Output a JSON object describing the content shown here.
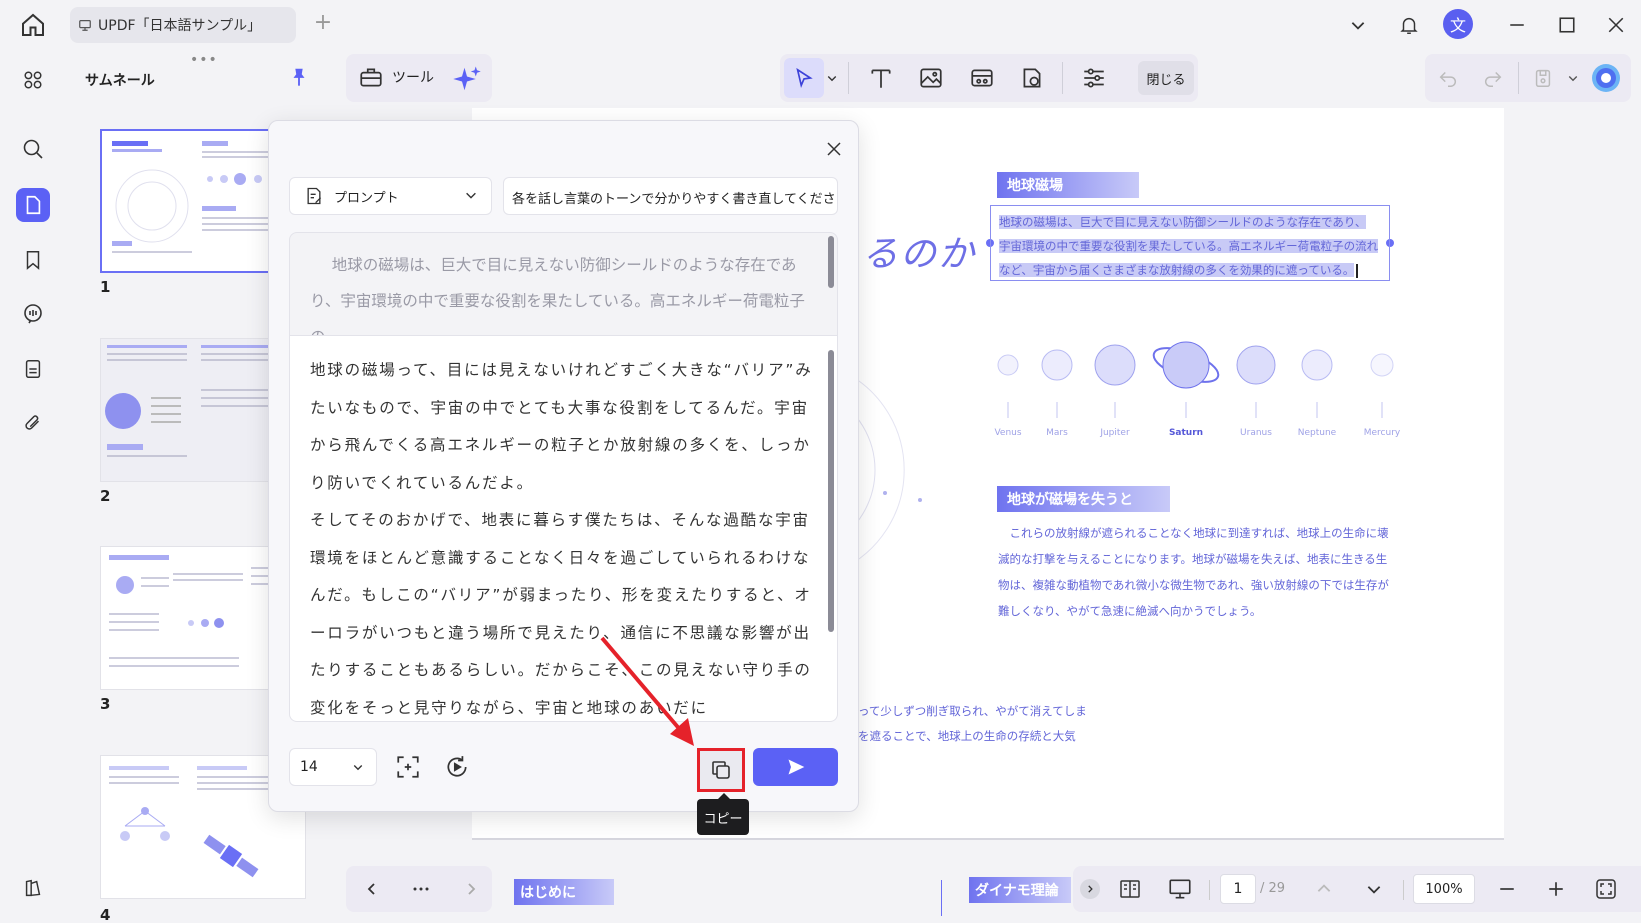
{
  "titlebar": {
    "tab_title": "UPDF「日本語サンプル」",
    "avatar_letter": "文"
  },
  "thumbnail_panel": {
    "title": "サムネール",
    "page_numbers": [
      "1",
      "2",
      "3",
      "4"
    ]
  },
  "toolbar": {
    "tools_label": "ツール",
    "close_label": "閉じる"
  },
  "document": {
    "title_fragment": "るのか",
    "section1_heading": "地球磁場",
    "section1_lines": [
      "地球の磁場は、巨大で目に見えない防御シールドのような存在であり、",
      "宇宙環境の中で重要な役割を果たしている。高エネルギー荷電粒子の流れ",
      "など、宇宙から届くさまざまな放射線の多くを効果的に遮っている。"
    ],
    "planets": [
      "Venus",
      "Mars",
      "Jupiter",
      "Saturn",
      "Uranus",
      "Neptune",
      "Mercury"
    ],
    "section2_heading": "地球が磁場を失うと",
    "section2_text": "これらの放射線が遮られることなく地球に到達すれば、地球上の生命に壊滅的な打撃を与えることになります。地球が磁場を失えば、地表に生きる生物は、複雑な動植物であれ微小な微生物であれ、強い放射線の下では生存が難しくなり、やがて急速に絶滅へ向かうでしょう。",
    "fragment1": "って少しずつ削ぎ取られ、やがて消えてしま",
    "fragment2": "を遮ることで、地球上の生命の存続と大気",
    "bookmark_left": "はじめに",
    "bookmark_right": "ダイナモ理論"
  },
  "ai_dialog": {
    "prompt_label": "プロンプト",
    "prompt_text": "各を話し言葉のトーンで分かりやすく書き直してください",
    "source_text": "地球の磁場は、巨大で目に見えない防御シールドのような存在であり、宇宙環境の中で重要な役割を果たしている。高エネルギー荷電粒子の",
    "result_paragraph1": "地球の磁場って、目には見えないけれどすごく大きな“バリア”みたいなもので、宇宙の中でとても大事な役割をしてるんだ。宇宙から飛んでくる高エネルギーの粒子とか放射線の多くを、しっかり防いでくれているんだよ。",
    "result_paragraph2": "そしてそのおかげで、地表に暮らす僕たちは、そんな過酷な宇宙環境をほとんど意識することなく日々を過ごしていられるわけなんだ。もしこの“バリア”が弱まったり、形を変えたりすると、オーロラがいつもと違う場所で見えたり、通信に不思議な影響が出たりすることもあるらしい。だからこそ、この見えない守り手の変化をそっと見守りながら、宇宙と地球のあいだに",
    "font_size": "14",
    "tooltip": "コピー"
  },
  "statusbar": {
    "current_page": "1",
    "total_pages": "/ 29",
    "zoom": "100%"
  },
  "colors": {
    "accent": "#5b61f5",
    "highlight": "#e5222a"
  }
}
